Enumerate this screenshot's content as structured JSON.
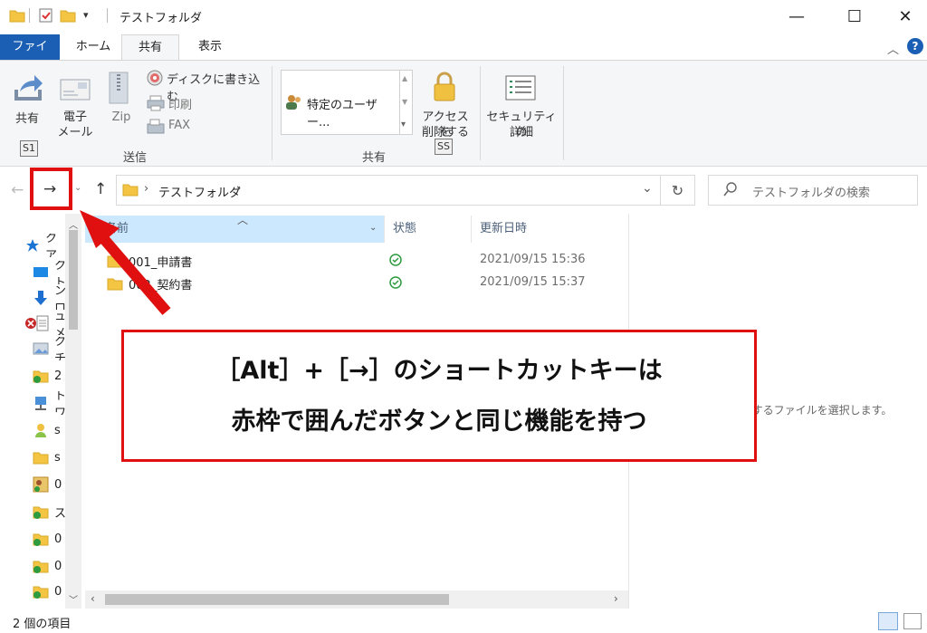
{
  "window": {
    "title": "テストフォルダ",
    "minimize": "—",
    "maximize": "☐",
    "close": "✕"
  },
  "ribbon_tabs": [
    "ファイル",
    "ホーム",
    "共有",
    "表示"
  ],
  "ribbon": {
    "share_btn": "共有",
    "share_keytip": "S1",
    "email_btn": [
      "電子",
      "メール"
    ],
    "zip_btn": "Zip",
    "burn_btn": "ディスクに書き込む",
    "print_btn": "印刷",
    "fax_btn": "FAX",
    "group_send": "送信",
    "share_with_select": "特定のユーザー...",
    "remove_access": [
      "アクセスを",
      "削除する"
    ],
    "remove_keytip": "SS",
    "group_share": "共有",
    "security": [
      "セキュリティの",
      "詳細"
    ]
  },
  "address": {
    "path": "テストフォルダ",
    "search_placeholder": "テストフォルダの検索"
  },
  "columns": {
    "name": "名前",
    "status": "状態",
    "modified": "更新日時"
  },
  "files": [
    {
      "name": "001_申請書",
      "date": "2021/09/15 15:36",
      "status": "synced"
    },
    {
      "name": "002_契約書",
      "date": "2021/09/15 15:37",
      "status": "synced"
    }
  ],
  "nav_items": [
    "クイックアクセス",
    "デスクトップ",
    "ダウンロード",
    "ドキュメント",
    "ピクチャ",
    "2",
    "ネットワーク",
    "s",
    "s",
    "0",
    "ス",
    "0",
    "0",
    "0"
  ],
  "preview_message": "プレビューを表示するファイルを選択します。",
  "status_bar": "2 個の項目",
  "callout": {
    "line1": "［Alt］+［→］のショートカットキーは",
    "line2": "赤枠で囲んだボタンと同じ機能を持つ"
  },
  "colors": {
    "annotation_red": "#e01010",
    "file_tab_blue": "#1a5fb4",
    "folder_yellow": "#f4c542",
    "sync_green": "#2e9b3e"
  }
}
